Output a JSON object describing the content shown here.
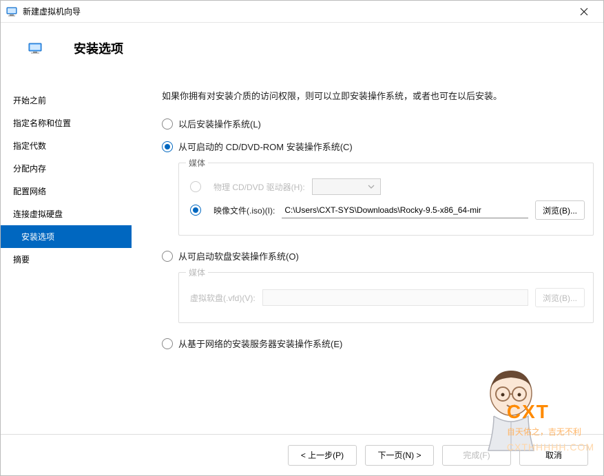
{
  "titlebar": {
    "title": "新建虚拟机向导"
  },
  "header": {
    "title": "安装选项"
  },
  "sidebar": {
    "steps": [
      {
        "label": "开始之前"
      },
      {
        "label": "指定名称和位置"
      },
      {
        "label": "指定代数"
      },
      {
        "label": "分配内存"
      },
      {
        "label": "配置网络"
      },
      {
        "label": "连接虚拟硬盘"
      },
      {
        "label": "安装选项"
      },
      {
        "label": "摘要"
      }
    ]
  },
  "content": {
    "intro": "如果你拥有对安装介质的访问权限，则可以立即安装操作系统，或者也可在以后安装。",
    "opt_later": "以后安装操作系统(L)",
    "opt_cd": "从可启动的 CD/DVD-ROM 安装操作系统(C)",
    "media_group": "媒体",
    "opt_physical": "物理 CD/DVD 驱动器(H):",
    "opt_iso": "映像文件(.iso)(I):",
    "iso_value": "C:\\Users\\CXT-SYS\\Downloads\\Rocky-9.5-x86_64-mir",
    "browse": "浏览(B)...",
    "opt_floppy": "从可启动软盘安装操作系统(O)",
    "floppy_label": "虚拟软盘(.vfd)(V):",
    "opt_network": "从基于网络的安装服务器安装操作系统(E)"
  },
  "footer": {
    "prev": "< 上一步(P)",
    "next": "下一页(N) >",
    "finish": "完成(F)",
    "cancel": "取消"
  },
  "watermark": {
    "l1": "CXT",
    "l2": "自天佑之，吉无不利",
    "l3": "CXTHHHHH.COM"
  }
}
